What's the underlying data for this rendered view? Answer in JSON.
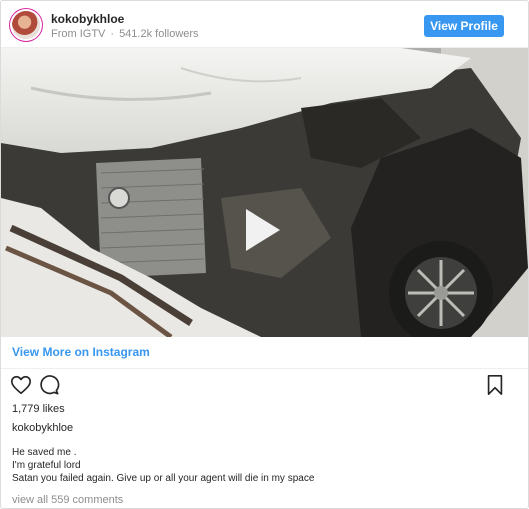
{
  "header": {
    "username": "kokobykhloe",
    "source": "From IGTV",
    "separator": "·",
    "followers": "541.2k followers",
    "view_profile_label": "View Profile"
  },
  "post": {
    "view_more_label": "View More on Instagram",
    "likes": "1,779 likes",
    "owner": "kokobykhloe",
    "caption_lines": [
      "He saved me .",
      "I'm grateful lord",
      "Satan you failed again. Give up or all your agent will die in my space"
    ],
    "comments_link": "view all 559 comments"
  },
  "colors": {
    "accent": "#3897f0",
    "text": "#262626",
    "muted": "#8e8e8e",
    "border": "#dbdbdb"
  },
  "icons": {
    "like": "heart-outline-icon",
    "comment": "comment-bubble-icon",
    "save": "bookmark-outline-icon",
    "play": "play-icon"
  }
}
